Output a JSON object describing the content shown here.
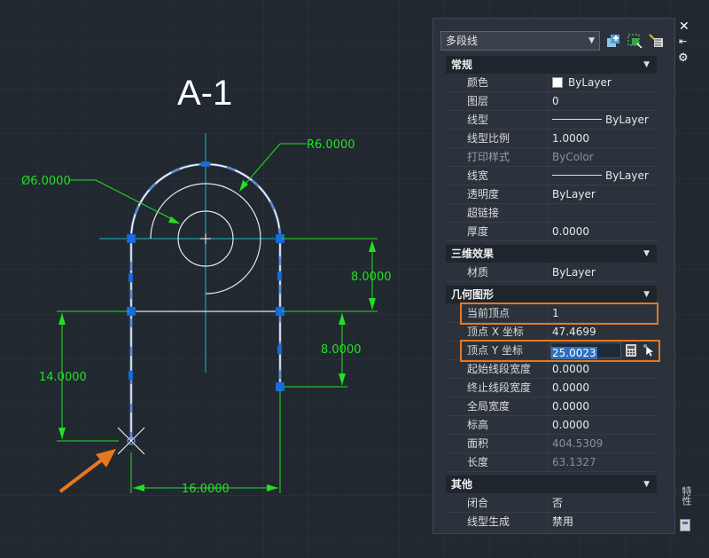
{
  "drawing": {
    "title": "A-1",
    "dims": {
      "dia": "Ø6.0000",
      "radius": "R6.0000",
      "right_top": "8.0000",
      "right_mid": "8.0000",
      "left_height": "14.0000",
      "bottom_width": "16.0000"
    }
  },
  "palette": {
    "object_type": "多段线",
    "side_label": "特性",
    "sections": {
      "general": {
        "title": "常规",
        "rows": [
          {
            "name": "颜色",
            "value": "ByLayer"
          },
          {
            "name": "图层",
            "value": "0"
          },
          {
            "name": "线型",
            "value": "ByLayer"
          },
          {
            "name": "线型比例",
            "value": "1.0000"
          },
          {
            "name": "打印样式",
            "value": "ByColor"
          },
          {
            "name": "线宽",
            "value": "ByLayer"
          },
          {
            "name": "透明度",
            "value": "ByLayer"
          },
          {
            "name": "超链接",
            "value": ""
          },
          {
            "name": "厚度",
            "value": "0.0000"
          }
        ]
      },
      "threed": {
        "title": "三维效果",
        "rows": [
          {
            "name": "材质",
            "value": "ByLayer"
          }
        ]
      },
      "geometry": {
        "title": "几何图形",
        "rows": [
          {
            "name": "当前顶点",
            "value": "1"
          },
          {
            "name": "顶点 X 坐标",
            "value": "47.4699"
          },
          {
            "name": "顶点 Y 坐标",
            "value": "25.0023"
          },
          {
            "name": "起始线段宽度",
            "value": "0.0000"
          },
          {
            "name": "终止线段宽度",
            "value": "0.0000"
          },
          {
            "name": "全局宽度",
            "value": "0.0000"
          },
          {
            "name": "标高",
            "value": "0.0000"
          },
          {
            "name": "面积",
            "value": "404.5309"
          },
          {
            "name": "长度",
            "value": "63.1327"
          }
        ]
      },
      "misc": {
        "title": "其他",
        "rows": [
          {
            "name": "闭合",
            "value": "否"
          },
          {
            "name": "线型生成",
            "value": "禁用"
          }
        ]
      }
    }
  },
  "colors": {
    "background": "#212830",
    "dimension": "#22e022",
    "center": "#1fb8c8",
    "highlight": "#e8771e"
  }
}
